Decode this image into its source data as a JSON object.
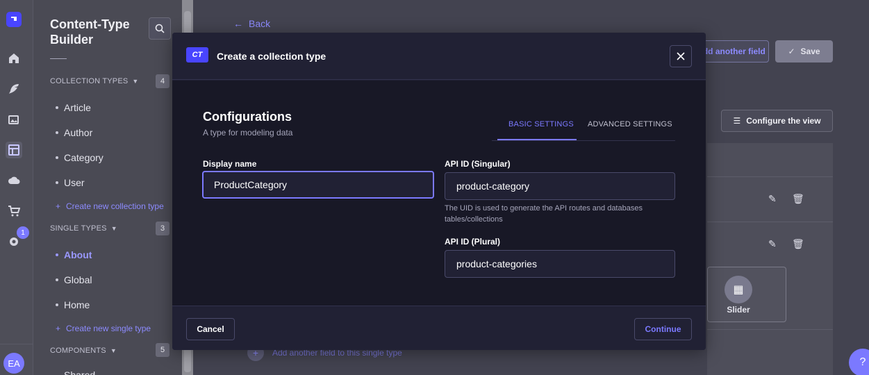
{
  "rail": {
    "icons": [
      "strapi-logo-icon",
      "home-icon",
      "feather-icon",
      "media-icon",
      "content-type-builder-icon",
      "cloud-icon",
      "cart-icon",
      "settings-icon"
    ],
    "settings_badge": "1",
    "avatar": "EA"
  },
  "subnav": {
    "title": "Content-Type Builder",
    "collection_types": {
      "heading": "COLLECTION TYPES",
      "count": "4",
      "items": [
        "Article",
        "Author",
        "Category",
        "User"
      ],
      "create_label": "Create new collection type"
    },
    "single_types": {
      "heading": "SINGLE TYPES",
      "count": "3",
      "items": [
        "About",
        "Global",
        "Home"
      ],
      "active": "About",
      "create_label": "Create new single type"
    },
    "components": {
      "heading": "COMPONENTS",
      "count": "5",
      "first_item_partial": "Shared"
    }
  },
  "main": {
    "back_label": "Back",
    "add_field_label": "Add another field",
    "save_label": "Save",
    "configure_label": "Configure the view",
    "slider_label": "Slider",
    "add_single_label": "Add another field to this single type"
  },
  "modal": {
    "badge": "CT",
    "title": "Create a collection type",
    "section_title": "Configurations",
    "section_subtitle": "A type for modeling data",
    "tabs": [
      "BASIC SETTINGS",
      "ADVANCED SETTINGS"
    ],
    "active_tab": "BASIC SETTINGS",
    "display_name_label": "Display name",
    "display_name_value": "ProductCategory",
    "api_singular_label": "API ID (Singular)",
    "api_singular_value": "product-category",
    "api_singular_hint": "The UID is used to generate the API routes and databases tables/collections",
    "api_plural_label": "API ID (Plural)",
    "api_plural_value": "product-categories",
    "cancel_label": "Cancel",
    "continue_label": "Continue"
  },
  "colors": {
    "accent": "#7b79ff",
    "brand": "#4945ff",
    "modal_bg": "#212134",
    "modal_body": "#181826"
  }
}
